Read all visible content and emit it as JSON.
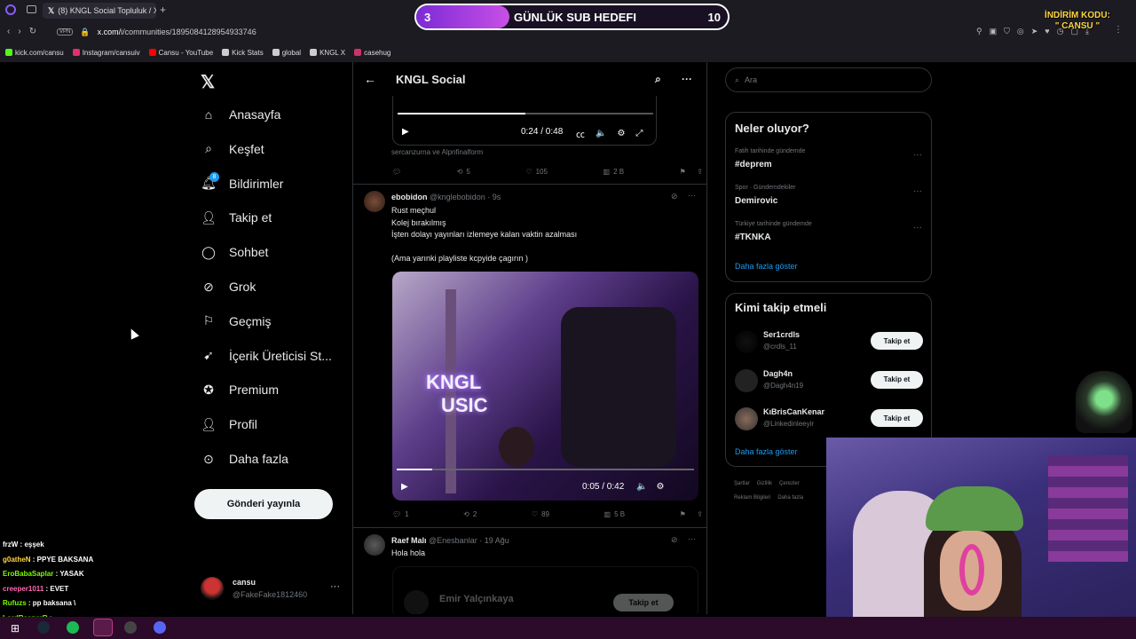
{
  "browser": {
    "tab_title": "(8) KNGL Social Topluluk / X",
    "url_prefix": "x.com/",
    "url_path": "i/communities/1895084128954933746",
    "vpn_label": "VPN",
    "bookmarks": [
      {
        "label": "kick.com/cansu",
        "color": "#53fc18"
      },
      {
        "label": "Instagram/cansuiv",
        "color": "#e1306c"
      },
      {
        "label": "Cansu - YouTube",
        "color": "#ff0000"
      },
      {
        "label": "Kick Stats",
        "color": "#cccccc"
      },
      {
        "label": "global",
        "color": "#cccccc"
      },
      {
        "label": "KNGL X",
        "color": "#cccccc"
      },
      {
        "label": "casehug",
        "color": "#cc3366"
      }
    ]
  },
  "overlay": {
    "goal_current": "3",
    "goal_label": "GÜNLÜK SUB HEDEFI",
    "goal_target": "10",
    "goal_progress": 0.3,
    "promo_line1": "İNDİRİM KODU:",
    "promo_line2": "\" CANSU \""
  },
  "sidebar": {
    "items": [
      {
        "label": "Anasayfa",
        "icon": "home-icon"
      },
      {
        "label": "Keşfet",
        "icon": "search-icon"
      },
      {
        "label": "Bildirimler",
        "icon": "bell-icon",
        "badge": "8"
      },
      {
        "label": "Takip et",
        "icon": "add-user-icon"
      },
      {
        "label": "Sohbet",
        "icon": "chat-bubble-icon"
      },
      {
        "label": "Grok",
        "icon": "grok-icon"
      },
      {
        "label": "Geçmiş",
        "icon": "bookmark-icon"
      },
      {
        "label": "İçerik Üreticisi St...",
        "icon": "rocket-icon"
      },
      {
        "label": "Premium",
        "icon": "verified-icon"
      },
      {
        "label": "Profil",
        "icon": "person-icon"
      },
      {
        "label": "Daha fazla",
        "icon": "more-circle-icon"
      }
    ],
    "post_button": "Gönderi yayınla",
    "account_name": "cansu",
    "account_handle": "@FakeFake1812460"
  },
  "feed": {
    "title": "KNGL Social",
    "video1": {
      "time": "0:24 / 0:48",
      "progress": 0.5
    },
    "video1_credit": "sercanzurna ve Alpnfinalform",
    "video1_actions": {
      "likes": "105",
      "reposts": "5",
      "views": "2 B"
    },
    "tweet1": {
      "name": "ebobidon",
      "handle": "@knglebobidon · 9s",
      "lines": [
        "Rust meçhul",
        "Kolej bırakılmış",
        "İşten dolayı yayınları izlemeye kalan vaktin azalması",
        "",
        "(Ama yarınki playliste kcpyide çagırın )"
      ],
      "video_time": "0:05 / 0:42",
      "video_progress": 0.12,
      "video_neon": "KNGL",
      "video_neon2": "USIC",
      "replies": "1",
      "reposts": "2",
      "likes": "89",
      "views": "5 B"
    },
    "tweet2": {
      "name": "Raef Malı",
      "handle": "@Enesbanlar · 19 Ağu",
      "text": "Hola hola",
      "quoted_name": "Emir Yalçınkaya",
      "quoted_button": "Takip et"
    }
  },
  "right": {
    "search_placeholder": "Ara",
    "trends_title": "Neler oluyor?",
    "trends": [
      {
        "category": "Fatih tarihinde gündemde",
        "name": "#deprem"
      },
      {
        "category": "Spor · Gündemdekiler",
        "name": "Demirovic"
      },
      {
        "category": "Türkiye tarihinde gündemde",
        "name": "#TKNKA"
      }
    ],
    "show_more": "Daha fazla göster",
    "who_title": "Kimi takip etmeli",
    "who": [
      {
        "name": "Ser1crdls",
        "handle": "@crdls_11"
      },
      {
        "name": "Dagh4n",
        "handle": "@Dagh4n19"
      },
      {
        "name": "KıBrisCanKenar",
        "handle": "@Linkedinleeyir"
      }
    ],
    "follow_label": "Takip et",
    "footer1": [
      "Şartlar",
      "Gizlilik",
      "Çerezler"
    ],
    "footer2": [
      "Reklam Bilgileri",
      "Daha fazla"
    ]
  },
  "chat": [
    {
      "user": "frzW",
      "msg": "eşşek",
      "color": "#ffffff"
    },
    {
      "user": "g0atheN",
      "msg": "PPYE BAKSANA",
      "color": "#ffd740"
    },
    {
      "user": "EroBabaSaplar",
      "msg": "YASAK",
      "color": "#7cfc00"
    },
    {
      "user": "creeper1011",
      "msg": "EVET",
      "color": "#ff69b4"
    },
    {
      "user": "Rufuzs",
      "msg": "pp baksana \\",
      "color": "#7cfc00"
    },
    {
      "user": "LordReaperR",
      "msg": "",
      "color": "#7cfc00"
    }
  ]
}
